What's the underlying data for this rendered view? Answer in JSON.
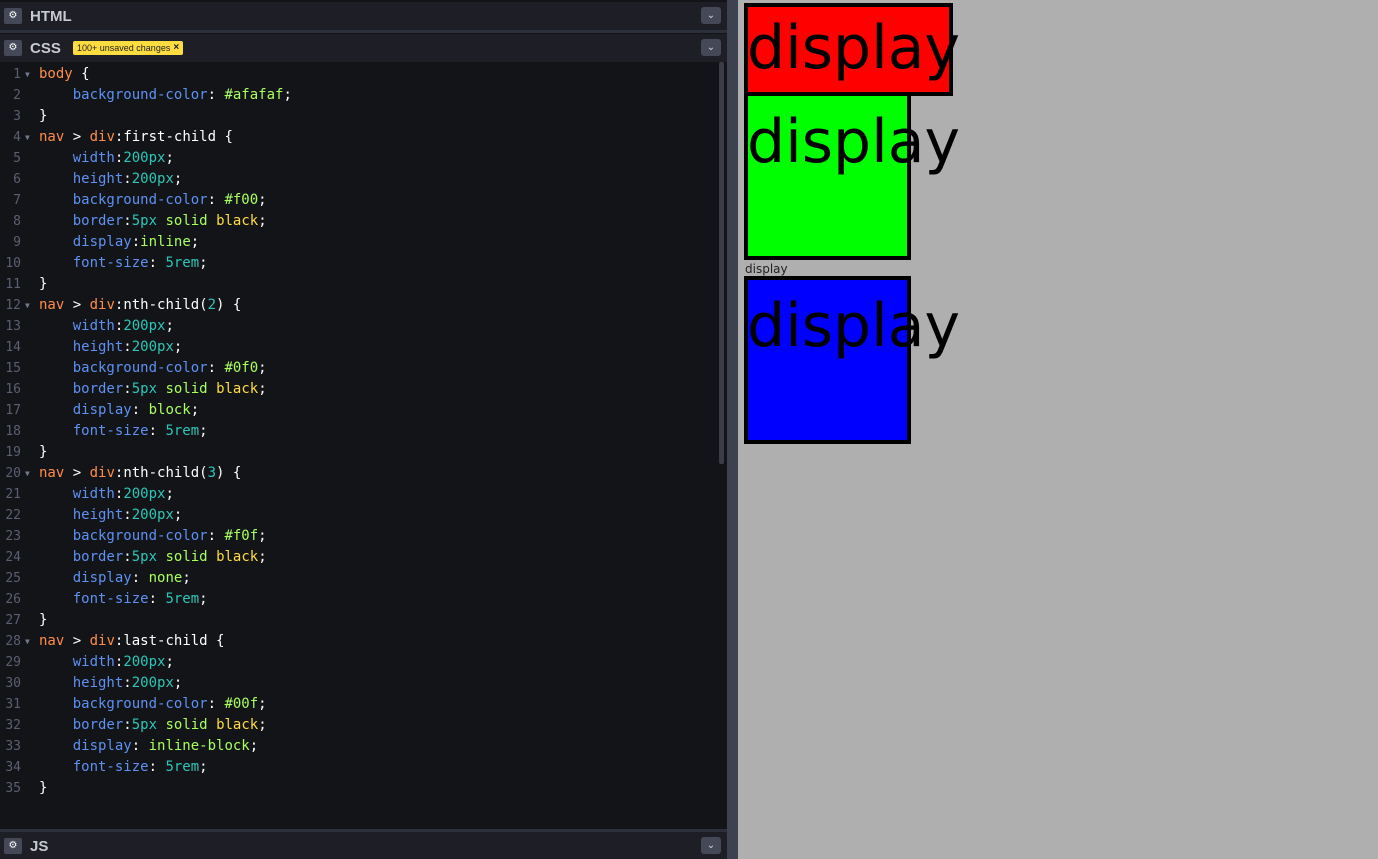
{
  "panels": {
    "html": {
      "title": "HTML",
      "gear_icon": "gear-icon",
      "collapse_icon": "chevron-down-icon"
    },
    "css": {
      "title": "CSS",
      "badge": "100+ unsaved changes",
      "badge_close": "×",
      "gear_icon": "gear-icon",
      "collapse_icon": "chevron-down-icon"
    },
    "js": {
      "title": "JS",
      "gear_icon": "gear-icon",
      "collapse_icon": "chevron-down-icon"
    }
  },
  "css_code": [
    {
      "n": "1",
      "fold": true,
      "tokens": [
        [
          "sel",
          "body"
        ],
        [
          "pun",
          " {"
        ]
      ]
    },
    {
      "n": "2",
      "fold": false,
      "tokens": [
        [
          "pun",
          "    "
        ],
        [
          "prop",
          "background-color"
        ],
        [
          "pun",
          ": "
        ],
        [
          "val",
          "#afafaf"
        ],
        [
          "pun",
          ";"
        ]
      ]
    },
    {
      "n": "3",
      "fold": false,
      "tokens": [
        [
          "pun",
          "}"
        ]
      ]
    },
    {
      "n": "4",
      "fold": true,
      "tokens": [
        [
          "sel",
          "nav"
        ],
        [
          "pun",
          " > "
        ],
        [
          "sel",
          "div"
        ],
        [
          "pun",
          ":first-child {"
        ]
      ]
    },
    {
      "n": "5",
      "fold": false,
      "tokens": [
        [
          "pun",
          "    "
        ],
        [
          "prop",
          "width"
        ],
        [
          "pun",
          ":"
        ],
        [
          "num",
          "200px"
        ],
        [
          "pun",
          ";"
        ]
      ]
    },
    {
      "n": "6",
      "fold": false,
      "tokens": [
        [
          "pun",
          "    "
        ],
        [
          "prop",
          "height"
        ],
        [
          "pun",
          ":"
        ],
        [
          "num",
          "200px"
        ],
        [
          "pun",
          ";"
        ]
      ]
    },
    {
      "n": "7",
      "fold": false,
      "tokens": [
        [
          "pun",
          "    "
        ],
        [
          "prop",
          "background-color"
        ],
        [
          "pun",
          ": "
        ],
        [
          "val",
          "#f00"
        ],
        [
          "pun",
          ";"
        ]
      ]
    },
    {
      "n": "8",
      "fold": false,
      "tokens": [
        [
          "pun",
          "    "
        ],
        [
          "prop",
          "border"
        ],
        [
          "pun",
          ":"
        ],
        [
          "num",
          "5px"
        ],
        [
          "pun",
          " "
        ],
        [
          "val",
          "solid"
        ],
        [
          "pun",
          " "
        ],
        [
          "kw",
          "black"
        ],
        [
          "pun",
          ";"
        ]
      ]
    },
    {
      "n": "9",
      "fold": false,
      "tokens": [
        [
          "pun",
          "    "
        ],
        [
          "prop",
          "display"
        ],
        [
          "pun",
          ":"
        ],
        [
          "val",
          "inline"
        ],
        [
          "pun",
          ";"
        ]
      ]
    },
    {
      "n": "10",
      "fold": false,
      "tokens": [
        [
          "pun",
          "    "
        ],
        [
          "prop",
          "font-size"
        ],
        [
          "pun",
          ": "
        ],
        [
          "num",
          "5rem"
        ],
        [
          "pun",
          ";"
        ]
      ]
    },
    {
      "n": "11",
      "fold": false,
      "tokens": [
        [
          "pun",
          "}"
        ]
      ]
    },
    {
      "n": "12",
      "fold": true,
      "tokens": [
        [
          "sel",
          "nav"
        ],
        [
          "pun",
          " > "
        ],
        [
          "sel",
          "div"
        ],
        [
          "pun",
          ":nth-child("
        ],
        [
          "num",
          "2"
        ],
        [
          "pun",
          ") {"
        ]
      ]
    },
    {
      "n": "13",
      "fold": false,
      "tokens": [
        [
          "pun",
          "    "
        ],
        [
          "prop",
          "width"
        ],
        [
          "pun",
          ":"
        ],
        [
          "num",
          "200px"
        ],
        [
          "pun",
          ";"
        ]
      ]
    },
    {
      "n": "14",
      "fold": false,
      "tokens": [
        [
          "pun",
          "    "
        ],
        [
          "prop",
          "height"
        ],
        [
          "pun",
          ":"
        ],
        [
          "num",
          "200px"
        ],
        [
          "pun",
          ";"
        ]
      ]
    },
    {
      "n": "15",
      "fold": false,
      "tokens": [
        [
          "pun",
          "    "
        ],
        [
          "prop",
          "background-color"
        ],
        [
          "pun",
          ": "
        ],
        [
          "val",
          "#0f0"
        ],
        [
          "pun",
          ";"
        ]
      ]
    },
    {
      "n": "16",
      "fold": false,
      "tokens": [
        [
          "pun",
          "    "
        ],
        [
          "prop",
          "border"
        ],
        [
          "pun",
          ":"
        ],
        [
          "num",
          "5px"
        ],
        [
          "pun",
          " "
        ],
        [
          "val",
          "solid"
        ],
        [
          "pun",
          " "
        ],
        [
          "kw",
          "black"
        ],
        [
          "pun",
          ";"
        ]
      ]
    },
    {
      "n": "17",
      "fold": false,
      "tokens": [
        [
          "pun",
          "    "
        ],
        [
          "prop",
          "display"
        ],
        [
          "pun",
          ": "
        ],
        [
          "val",
          "block"
        ],
        [
          "pun",
          ";"
        ]
      ]
    },
    {
      "n": "18",
      "fold": false,
      "tokens": [
        [
          "pun",
          "    "
        ],
        [
          "prop",
          "font-size"
        ],
        [
          "pun",
          ": "
        ],
        [
          "num",
          "5rem"
        ],
        [
          "pun",
          ";"
        ]
      ]
    },
    {
      "n": "19",
      "fold": false,
      "tokens": [
        [
          "pun",
          "}"
        ]
      ]
    },
    {
      "n": "20",
      "fold": true,
      "tokens": [
        [
          "sel",
          "nav"
        ],
        [
          "pun",
          " > "
        ],
        [
          "sel",
          "div"
        ],
        [
          "pun",
          ":nth-child("
        ],
        [
          "num",
          "3"
        ],
        [
          "pun",
          ") {"
        ]
      ]
    },
    {
      "n": "21",
      "fold": false,
      "tokens": [
        [
          "pun",
          "    "
        ],
        [
          "prop",
          "width"
        ],
        [
          "pun",
          ":"
        ],
        [
          "num",
          "200px"
        ],
        [
          "pun",
          ";"
        ]
      ]
    },
    {
      "n": "22",
      "fold": false,
      "tokens": [
        [
          "pun",
          "    "
        ],
        [
          "prop",
          "height"
        ],
        [
          "pun",
          ":"
        ],
        [
          "num",
          "200px"
        ],
        [
          "pun",
          ";"
        ]
      ]
    },
    {
      "n": "23",
      "fold": false,
      "tokens": [
        [
          "pun",
          "    "
        ],
        [
          "prop",
          "background-color"
        ],
        [
          "pun",
          ": "
        ],
        [
          "val",
          "#f0f"
        ],
        [
          "pun",
          ";"
        ]
      ]
    },
    {
      "n": "24",
      "fold": false,
      "tokens": [
        [
          "pun",
          "    "
        ],
        [
          "prop",
          "border"
        ],
        [
          "pun",
          ":"
        ],
        [
          "num",
          "5px"
        ],
        [
          "pun",
          " "
        ],
        [
          "val",
          "solid"
        ],
        [
          "pun",
          " "
        ],
        [
          "kw",
          "black"
        ],
        [
          "pun",
          ";"
        ]
      ]
    },
    {
      "n": "25",
      "fold": false,
      "tokens": [
        [
          "pun",
          "    "
        ],
        [
          "prop",
          "display"
        ],
        [
          "pun",
          ": "
        ],
        [
          "val",
          "none"
        ],
        [
          "pun",
          ";"
        ]
      ]
    },
    {
      "n": "26",
      "fold": false,
      "tokens": [
        [
          "pun",
          "    "
        ],
        [
          "prop",
          "font-size"
        ],
        [
          "pun",
          ": "
        ],
        [
          "num",
          "5rem"
        ],
        [
          "pun",
          ";"
        ]
      ]
    },
    {
      "n": "27",
      "fold": false,
      "tokens": [
        [
          "pun",
          "}"
        ]
      ]
    },
    {
      "n": "28",
      "fold": true,
      "tokens": [
        [
          "sel",
          "nav"
        ],
        [
          "pun",
          " > "
        ],
        [
          "sel",
          "div"
        ],
        [
          "pun",
          ":last-child {"
        ]
      ]
    },
    {
      "n": "29",
      "fold": false,
      "tokens": [
        [
          "pun",
          "    "
        ],
        [
          "prop",
          "width"
        ],
        [
          "pun",
          ":"
        ],
        [
          "num",
          "200px"
        ],
        [
          "pun",
          ";"
        ]
      ]
    },
    {
      "n": "30",
      "fold": false,
      "tokens": [
        [
          "pun",
          "    "
        ],
        [
          "prop",
          "height"
        ],
        [
          "pun",
          ":"
        ],
        [
          "num",
          "200px"
        ],
        [
          "pun",
          ";"
        ]
      ]
    },
    {
      "n": "31",
      "fold": false,
      "tokens": [
        [
          "pun",
          "    "
        ],
        [
          "prop",
          "background-color"
        ],
        [
          "pun",
          ": "
        ],
        [
          "val",
          "#00f"
        ],
        [
          "pun",
          ";"
        ]
      ]
    },
    {
      "n": "32",
      "fold": false,
      "tokens": [
        [
          "pun",
          "    "
        ],
        [
          "prop",
          "border"
        ],
        [
          "pun",
          ":"
        ],
        [
          "num",
          "5px"
        ],
        [
          "pun",
          " "
        ],
        [
          "val",
          "solid"
        ],
        [
          "pun",
          " "
        ],
        [
          "kw",
          "black"
        ],
        [
          "pun",
          ";"
        ]
      ]
    },
    {
      "n": "33",
      "fold": false,
      "tokens": [
        [
          "pun",
          "    "
        ],
        [
          "prop",
          "display"
        ],
        [
          "pun",
          ": "
        ],
        [
          "val",
          "inline-block"
        ],
        [
          "pun",
          ";"
        ]
      ]
    },
    {
      "n": "34",
      "fold": false,
      "tokens": [
        [
          "pun",
          "    "
        ],
        [
          "prop",
          "font-size"
        ],
        [
          "pun",
          ": "
        ],
        [
          "num",
          "5rem"
        ],
        [
          "pun",
          ";"
        ]
      ]
    },
    {
      "n": "35",
      "fold": false,
      "tokens": [
        [
          "pun",
          "}"
        ]
      ]
    }
  ],
  "preview": {
    "background": "#afafaf",
    "box1_text": "display",
    "box1_color": "#ff0000",
    "box2_text": "display",
    "box2_color": "#00ff00",
    "plain_text": "display",
    "box4_text": "display",
    "box4_color": "#0000ff"
  }
}
